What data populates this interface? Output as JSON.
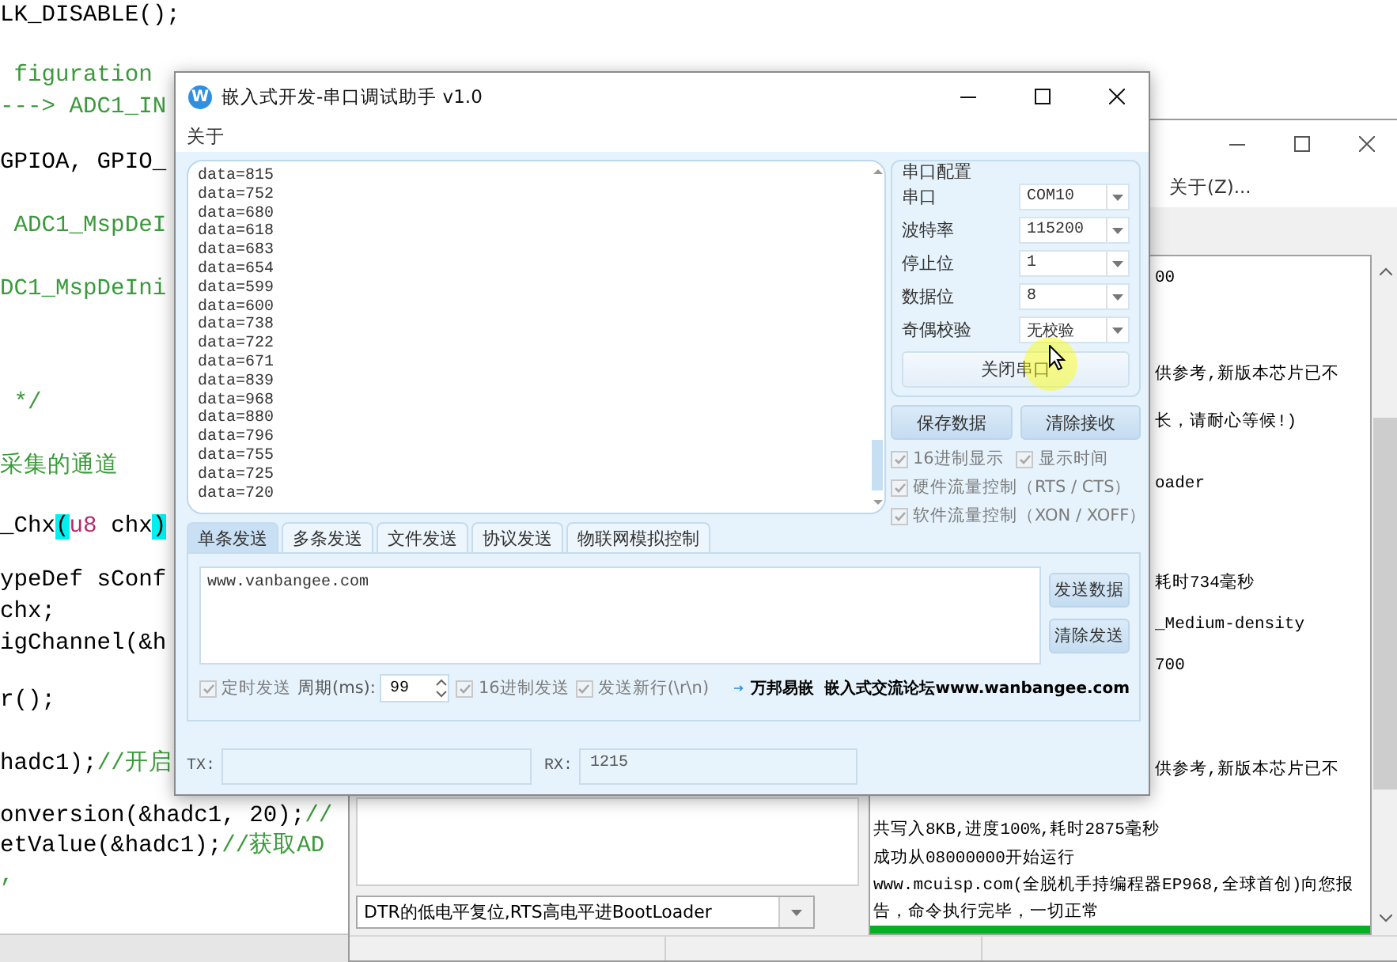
{
  "code_editor": {
    "lines": [
      {
        "segments": [
          {
            "kind": "code",
            "text": "LK_DISABLE();"
          }
        ]
      },
      {
        "segments": [
          {
            "kind": "comment",
            "text": " figuration"
          }
        ]
      },
      {
        "segments": [
          {
            "kind": "comment",
            "text": "---> ADC1_IN"
          }
        ]
      },
      {
        "segments": [
          {
            "kind": "code",
            "text": "GPIOA, GPIO_"
          }
        ]
      },
      {
        "segments": [
          {
            "kind": "comment",
            "text": " ADC1_MspDeI"
          }
        ]
      },
      {
        "segments": [
          {
            "kind": "comment",
            "text": "DC1_MspDeIni"
          }
        ]
      },
      {
        "segments": [
          {
            "kind": "comment",
            "text": " */"
          }
        ]
      },
      {
        "segments": [
          {
            "kind": "comment",
            "text": "采集的通道"
          }
        ]
      },
      {
        "segments": [
          {
            "kind": "code",
            "text": "_Chx"
          },
          {
            "kind": "bracket",
            "text": "("
          },
          {
            "kind": "keyword",
            "text": "u8"
          },
          {
            "kind": "code",
            "text": " chx"
          },
          {
            "kind": "bracket",
            "text": ")"
          }
        ]
      },
      {
        "segments": [
          {
            "kind": "code",
            "text": "ypeDef sConf"
          }
        ]
      },
      {
        "segments": [
          {
            "kind": "code",
            "text": "chx;"
          }
        ]
      },
      {
        "segments": [
          {
            "kind": "code",
            "text": "igChannel(&h"
          }
        ]
      },
      {
        "segments": [
          {
            "kind": "code",
            "text": "r();"
          }
        ]
      },
      {
        "segments": [
          {
            "kind": "code",
            "text": "hadc1);"
          },
          {
            "kind": "comment",
            "text": "//开启"
          }
        ]
      },
      {
        "segments": [
          {
            "kind": "code",
            "text": "onversion(&hadc1, 20);"
          },
          {
            "kind": "comment",
            "text": "//"
          }
        ]
      },
      {
        "segments": [
          {
            "kind": "code",
            "text": "etValue(&hadc1);"
          },
          {
            "kind": "comment",
            "text": "//获取AD"
          }
        ]
      },
      {
        "segments": [
          {
            "kind": "comment",
            "text": ","
          }
        ]
      }
    ]
  },
  "flash_window": {
    "menu": [
      "关于(Z)..."
    ],
    "log_lines": [
      "00",
      "供参考,新版本芯片已不",
      "长，请耐心等候!)",
      "oader",
      "耗时734毫秒",
      "_Medium-density",
      "700",
      "供参考,新版本芯片已不",
      "共写入8KB,进度100%,耗时2875毫秒",
      "成功从08000000开始运行",
      "www.mcuisp.com(全脱机手持编程器EP968,全球首创)向您报",
      "告，命令执行完毕，一切正常"
    ],
    "progress": {
      "level": 1
    },
    "reset_mode": {
      "value": "DTR的低电平复位,RTS高电平进BootLoader"
    }
  },
  "main_window": {
    "icon_letter": "W",
    "title": "嵌入式开发-串口调试助手 v1.0",
    "menu": [
      "关于"
    ],
    "receive_lines": [
      "data=815",
      "data=752",
      "data=680",
      "data=618",
      "data=683",
      "data=654",
      "data=599",
      "data=600",
      "data=738",
      "data=722",
      "data=671",
      "data=839",
      "data=968",
      "data=880",
      "data=796",
      "data=755",
      "data=725",
      "data=720"
    ],
    "serial_config": {
      "title": "串口配置",
      "fields": [
        {
          "label": "串口",
          "value": "COM10"
        },
        {
          "label": "波特率",
          "value": "115200"
        },
        {
          "label": "停止位",
          "value": "1"
        },
        {
          "label": "数据位",
          "value": "8"
        },
        {
          "label": "奇偶校验",
          "value": "无校验"
        }
      ],
      "toggle_button": "关闭串口"
    },
    "receive_buttons": [
      "保存数据",
      "清除接收"
    ],
    "display_options": [
      {
        "label": "16进制显示",
        "checked": true,
        "disabled": true
      },
      {
        "label": "显示时间",
        "checked": true,
        "disabled": true
      },
      {
        "label": "硬件流量控制（RTS / CTS）",
        "checked": true,
        "disabled": true
      },
      {
        "label": "软件流量控制（XON / XOFF）",
        "checked": true,
        "disabled": true
      }
    ],
    "send_tabs": [
      {
        "label": "单条发送",
        "selected": true
      },
      {
        "label": "多条发送",
        "selected": false
      },
      {
        "label": "文件发送",
        "selected": false
      },
      {
        "label": "协议发送",
        "selected": false
      },
      {
        "label": "物联网模拟控制",
        "selected": false
      }
    ],
    "send_text": "www.vanbangee.com",
    "send_buttons": [
      "发送数据",
      "清除发送"
    ],
    "send_options": [
      {
        "kind": "checkbox",
        "label": "定时发送",
        "checked": true,
        "disabled": true
      },
      {
        "kind": "spin",
        "label": "周期(ms):",
        "value": "99"
      },
      {
        "kind": "checkbox",
        "label": "16进制发送",
        "checked": true,
        "disabled": true
      },
      {
        "kind": "checkbox",
        "label": "发送新行(\\r\\n)",
        "checked": true,
        "disabled": true
      }
    ],
    "promo": "万邦易嵌  嵌入式交流论坛www.wanbangee.com",
    "tx": {
      "label": "TX:"
    },
    "rx": {
      "label": "RX:",
      "value": "1215"
    }
  }
}
